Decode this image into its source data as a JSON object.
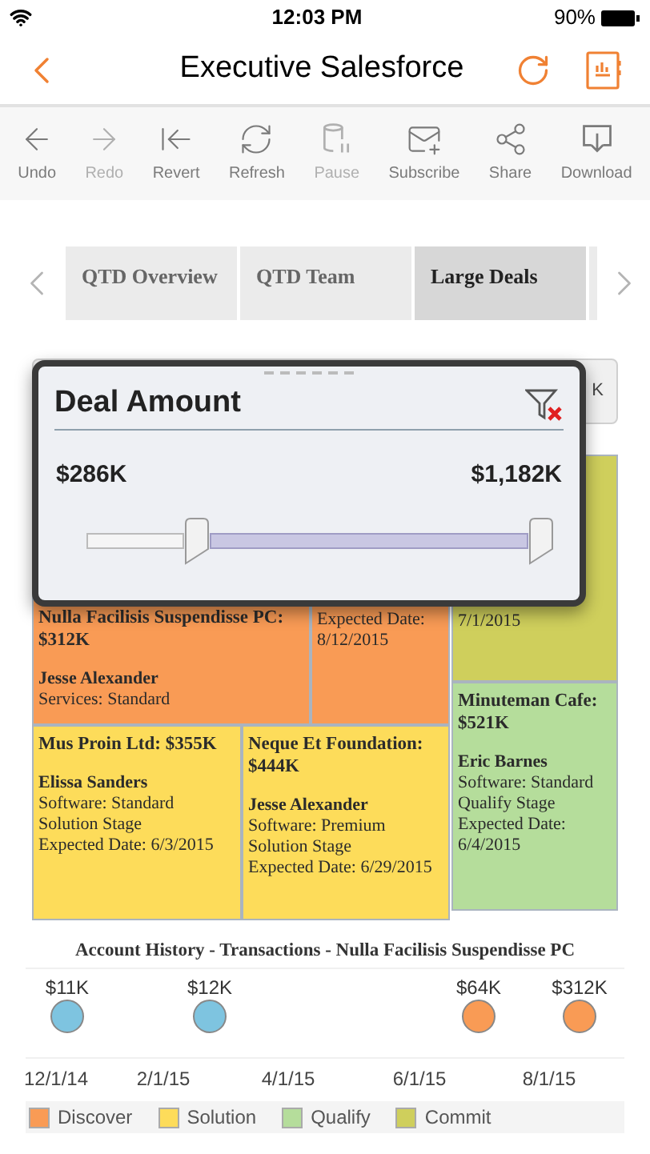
{
  "status_bar": {
    "time": "12:03 PM",
    "battery": "90%"
  },
  "nav": {
    "title": "Executive Salesforce"
  },
  "toolbar": [
    {
      "label": "Undo",
      "disabled": false
    },
    {
      "label": "Redo",
      "disabled": true
    },
    {
      "label": "Revert",
      "disabled": false
    },
    {
      "label": "Refresh",
      "disabled": false
    },
    {
      "label": "Pause",
      "disabled": true
    },
    {
      "label": "Subscribe",
      "disabled": false
    },
    {
      "label": "Share",
      "disabled": false
    },
    {
      "label": "Download",
      "disabled": false
    }
  ],
  "tabs": [
    {
      "label": "QTD Overview",
      "selected": false
    },
    {
      "label": "QTD Team",
      "selected": false
    },
    {
      "label": "Large Deals",
      "selected": true
    }
  ],
  "filter_field": {
    "value": "K"
  },
  "popup": {
    "title": "Deal Amount",
    "min": "$286K",
    "max": "$1,182K",
    "slider": {
      "low": {
        "level": 0.22
      },
      "high": {
        "level": 1
      }
    }
  },
  "treemap": {
    "left": [
      [
        {
          "color": "#f99b55",
          "heading": "Nulla Facilisis Suspendisse PC:",
          "amount": "$312K",
          "owner": "Jesse Alexander",
          "details": [
            "Services: Standard"
          ]
        },
        {
          "color": "#f99b55",
          "details": [
            "Expected Date:",
            "8/12/2015"
          ]
        }
      ],
      [
        {
          "color": "#fddc5a",
          "heading": "Mus Proin Ltd: $355K",
          "owner": "Elissa Sanders",
          "details": [
            "Software: Standard",
            "Solution Stage",
            "Expected Date: 6/3/2015"
          ]
        },
        {
          "color": "#fddc5a",
          "heading": "Neque Et Foundation: $444K",
          "owner": "Jesse Alexander",
          "details": [
            "Software: Premium",
            "Solution Stage",
            "Expected Date: 6/29/2015"
          ]
        }
      ]
    ],
    "right": [
      {
        "color": "#cfcf5c",
        "details": [
          "7/1/2015"
        ]
      },
      {
        "color": "#b5dd9b",
        "heading": "Minuteman Cafe: $521K",
        "owner": "Eric Barnes",
        "details": [
          "Software: Standard",
          "Qualify Stage",
          "Expected Date:",
          "6/4/2015"
        ]
      }
    ]
  },
  "history": {
    "title": "Account History - Transactions - Nulla Facilisis Suspendisse PC",
    "transactions": [
      {
        "amount": "$11K",
        "color": "#7ec4e0"
      },
      {
        "amount": "$12K",
        "color": "#7ec4e0"
      },
      {
        "amount": "$64K",
        "color": "#f99b55"
      },
      {
        "amount": "$312K",
        "color": "#f99b55"
      }
    ],
    "dates": [
      "12/1/14",
      "2/1/15",
      "4/1/15",
      "6/1/15",
      "8/1/15"
    ]
  },
  "legend": [
    {
      "label": "Discover",
      "color": "#f99b55"
    },
    {
      "label": "Solution",
      "color": "#fddc5a"
    },
    {
      "label": "Qualify",
      "color": "#b5dd9b"
    },
    {
      "label": "Commit",
      "color": "#cfcf5c"
    }
  ]
}
